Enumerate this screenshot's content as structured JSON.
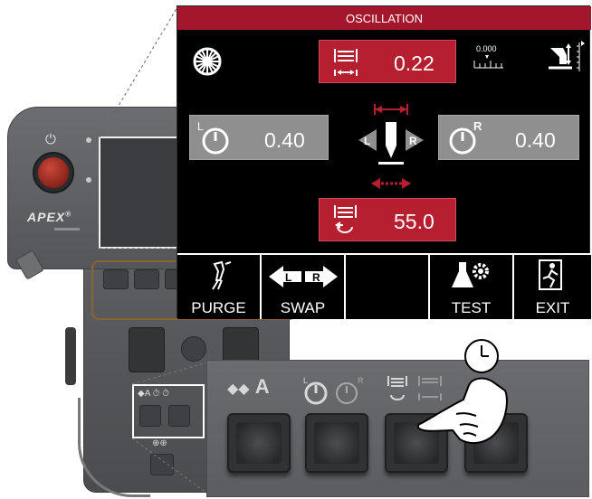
{
  "pendant": {
    "brand": "APEX",
    "brand_mark": "®"
  },
  "screen": {
    "title": "OSCILLATION",
    "width_value": "0.22",
    "dwell_left_value": "0.40",
    "dwell_right_value": "0.40",
    "speed_value": "55.0",
    "position_readout": "0.000",
    "dwell_left_letter": "L",
    "dwell_right_letter": "R",
    "nozzle_left": "L",
    "nozzle_right": "R"
  },
  "tabs": [
    {
      "label": "PURGE",
      "icon": "purge-torch-icon"
    },
    {
      "label": "SWAP",
      "icon": "swap-lr-icon"
    },
    {
      "label": "",
      "icon": ""
    },
    {
      "label": "TEST",
      "icon": "flask-gear-icon"
    },
    {
      "label": "EXIT",
      "icon": "exit-door-icon"
    }
  ],
  "keypad": {
    "key1_label": "A",
    "key2_left_letter": "L",
    "key2_right_letter": "R"
  },
  "colors": {
    "title_bar": "#a3162b",
    "active_panel": "#b61f2f",
    "inactive_panel": "#8f8f8f"
  }
}
